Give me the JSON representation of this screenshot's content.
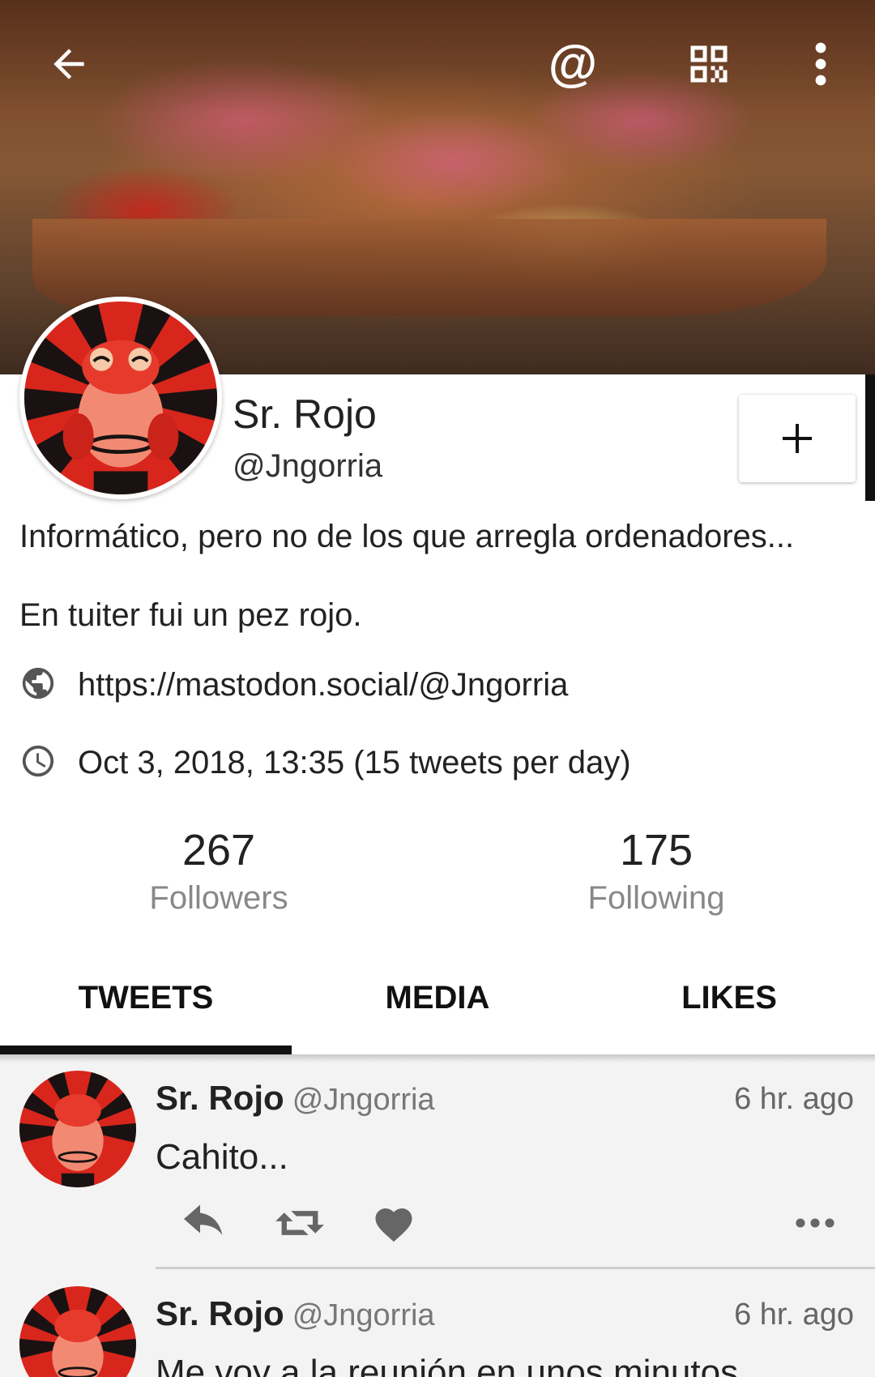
{
  "profile": {
    "display_name": "Sr. Rojo",
    "handle": "@Jngorria",
    "bio_line_1": "Informático, pero no de los que arregla ordenadores...",
    "bio_line_2": "En tuiter fui un pez rojo.",
    "website": "https://mastodon.social/@Jngorria",
    "joined": "Oct 3, 2018, 13:35 (15 tweets per day)",
    "followers_count": "267",
    "followers_label": "Followers",
    "following_count": "175",
    "following_label": "Following"
  },
  "topbar": {
    "icons": [
      "back-arrow-icon",
      "mention-icon",
      "qr-code-icon",
      "more-vertical-icon"
    ],
    "mention_glyph": "@"
  },
  "follow_button": {
    "icon": "plus-icon"
  },
  "tabs": [
    {
      "label": "TWEETS",
      "active": true
    },
    {
      "label": "MEDIA",
      "active": false
    },
    {
      "label": "LIKES",
      "active": false
    }
  ],
  "tweets": [
    {
      "name": "Sr. Rojo",
      "handle": "@Jngorria",
      "time": "6 hr. ago",
      "text": "Cahito..."
    },
    {
      "name": "Sr. Rojo",
      "handle": "@Jngorria",
      "time": "6 hr. ago",
      "text": "Me voy a la reunión en unos minutos"
    }
  ],
  "colors": {
    "accent_dark": "#111111",
    "avatar_red": "#d8261c",
    "avatar_dark": "#1a1212",
    "timeline_bg": "#f3f3f3"
  }
}
